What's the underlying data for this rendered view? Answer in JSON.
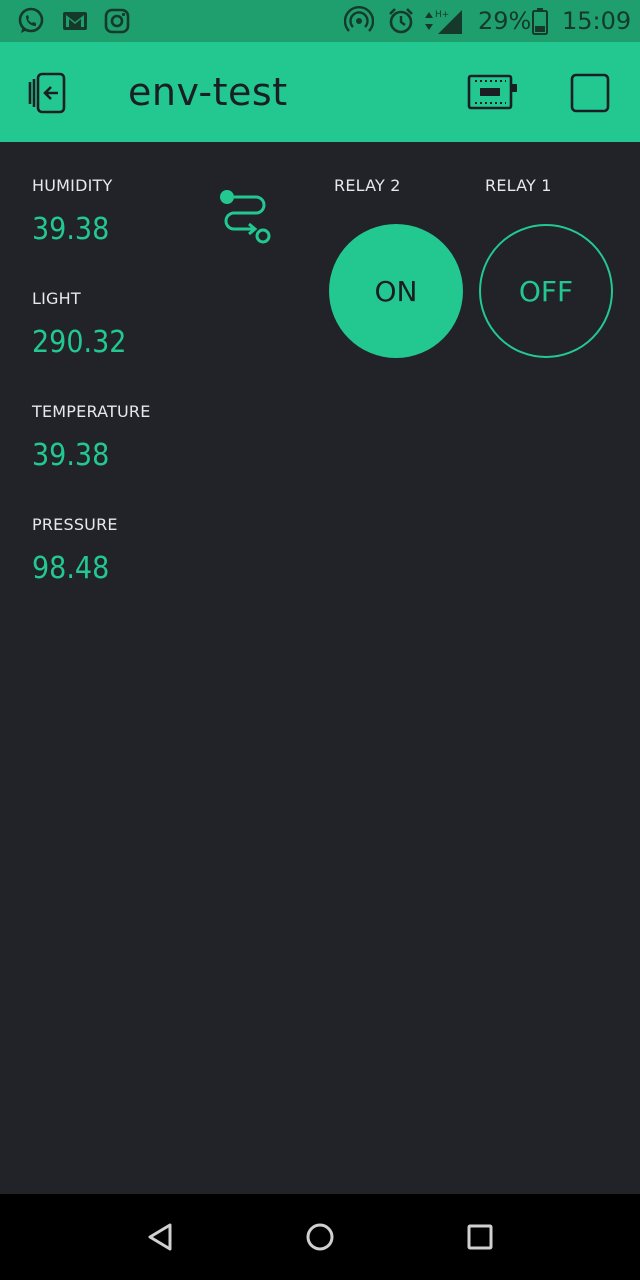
{
  "status_bar": {
    "battery_percent": "29%",
    "time": "15:09",
    "icons": [
      "whatsapp-icon",
      "gmail-icon",
      "instagram-icon",
      "hotspot-icon",
      "alarm-icon",
      "signal-icon",
      "battery-icon"
    ]
  },
  "app_bar": {
    "title": "env-test",
    "icons": [
      "exit-icon",
      "device-icon",
      "stop-icon"
    ]
  },
  "sensors": [
    {
      "label": "HUMIDITY",
      "value": "39.38"
    },
    {
      "label": "LIGHT",
      "value": "290.32"
    },
    {
      "label": "TEMPERATURE",
      "value": "39.38"
    },
    {
      "label": "PRESSURE",
      "value": "98.48"
    }
  ],
  "relays": [
    {
      "label": "RELAY 2",
      "state": "ON"
    },
    {
      "label": "RELAY 1",
      "state": "OFF"
    }
  ],
  "colors": {
    "accent": "#23c890",
    "background": "#212328",
    "status_bar": "#1f9e6e"
  }
}
